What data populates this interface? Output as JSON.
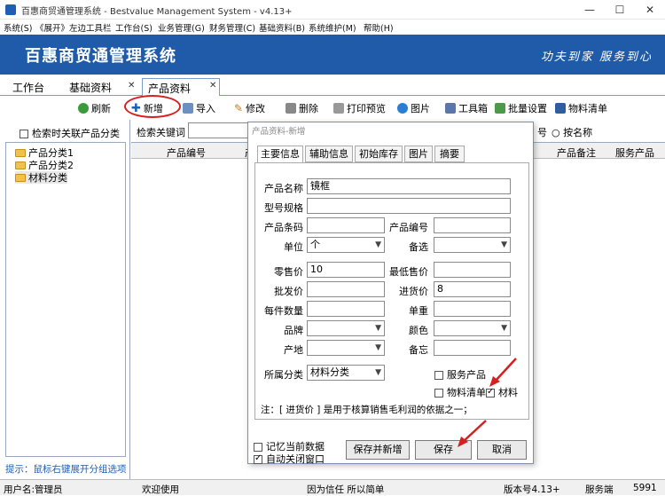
{
  "window": {
    "title": "百惠商贸通管理系统 - Bestvalue Management System - v4.13+"
  },
  "menu": [
    "系统(S)",
    "《展开》左边工具栏",
    "工作台(S)",
    "业务管理(G)",
    "财务管理(C)",
    "基础资料(B)",
    "系统维护(M)",
    "帮助(H)"
  ],
  "banner": {
    "system_name": "百惠商贸通管理系统",
    "slogan": "功夫到家 服务到心"
  },
  "tabs": [
    {
      "label": "工作台"
    },
    {
      "label": "基础资料"
    },
    {
      "label": "产品资料"
    }
  ],
  "toolbar": {
    "refresh": "刷新",
    "add": "新增",
    "import": "导入",
    "edit": "修改",
    "delete": "删除",
    "print_preview": "打印预览",
    "image": "图片",
    "toolbox": "工具箱",
    "batch_settings": "批量设置",
    "bom": "物料清单"
  },
  "left_panel": {
    "search_related_label": "检索时关联产品分类",
    "tree": [
      "产品分类1",
      "产品分类2",
      "材料分类"
    ],
    "tip": "提示：鼠标右键展开分组选项"
  },
  "search": {
    "keyword_label": "检索关键词",
    "opt1": "号",
    "opt2": "按名称"
  },
  "grid": {
    "columns": [
      "产品编号",
      "产",
      "产品备注",
      "服务产品"
    ]
  },
  "dialog": {
    "title": "产品资料-新增",
    "tabs": [
      "主要信息",
      "辅助信息",
      "初始库存",
      "图片",
      "摘要"
    ],
    "fields": {
      "name_label": "产品名称",
      "name_value": "镜框",
      "model_label": "型号规格",
      "model_value": "",
      "barcode_label": "产品条码",
      "barcode_value": "",
      "code_label": "产品编号",
      "code_value": "",
      "unit_label": "单位",
      "unit_value": "个",
      "alt_label": "备选",
      "alt_value": "",
      "retail_label": "零售价",
      "retail_value": "10",
      "min_price_label": "最低售价",
      "min_price_value": "",
      "wholesale_label": "批发价",
      "wholesale_value": "",
      "purchase_label": "进货价",
      "purchase_value": "8",
      "per_qty_label": "每件数量",
      "per_qty_value": "",
      "weight_label": "单重",
      "weight_value": "",
      "brand_label": "品牌",
      "brand_value": "",
      "color_label": "颜色",
      "color_value": "",
      "origin_label": "产地",
      "origin_value": "",
      "memo_label": "备忘",
      "memo_value": "",
      "category_label": "所属分类",
      "category_value": "材料分类"
    },
    "checks": {
      "service_product": "服务产品",
      "bom": "物料清单",
      "material": "材料"
    },
    "note": "注：[ 进货价 ] 是用于核算销售毛利润的依据之一；",
    "bottom_checks": {
      "remember": "记忆当前数据",
      "auto_close": "自动关闭窗口"
    },
    "buttons": {
      "save_new": "保存并新增",
      "save": "保存",
      "cancel": "取消"
    }
  },
  "status": {
    "user": "用户名:管理员",
    "welcome": "欢迎使用",
    "motto": "因为信任 所以简单",
    "version": "版本号4.13+",
    "server": "服务端",
    "port": "5991"
  },
  "colors": {
    "banner_bg": "#1f5ba8",
    "annotation_red": "#d62020",
    "tip_blue": "#1e5fb4"
  }
}
